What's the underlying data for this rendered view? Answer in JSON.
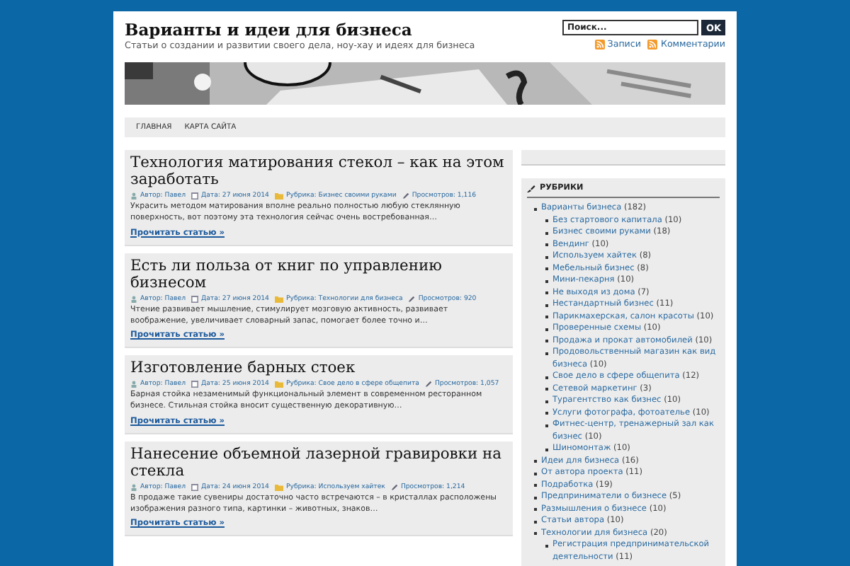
{
  "site": {
    "title": "Варианты и идеи для бизнеса",
    "tagline": "Статьи о создании и развитии своего дела, ноу-хау и идеях для бизнеса"
  },
  "search": {
    "placeholder": "Поиск...",
    "button": "OK"
  },
  "feeds": [
    "Записи",
    "Комментарии"
  ],
  "nav": [
    {
      "label": "ГЛАВНАЯ",
      "selected": false
    },
    {
      "label": "КАРТА САЙТА",
      "selected": false
    }
  ],
  "posts": [
    {
      "title": "Технология матирования стекол – как на этом заработать",
      "author": "Автор: Павел",
      "date": "Дата: 27 июня 2014",
      "category": "Рубрика: Бизнес своими руками",
      "views": "Просмотров: 1,116",
      "excerpt": "Украсить методом матирования вполне реально полностью любую стеклянную поверхность, вот поэтому эта технология сейчас очень востребованная…",
      "more": "Прочитать статью »"
    },
    {
      "title": "Есть ли польза от книг по управлению бизнесом",
      "author": "Автор: Павел",
      "date": "Дата: 27 июня 2014",
      "category": "Рубрика: Технологии для бизнеса",
      "views": "Просмотров: 920",
      "excerpt": "Чтение развивает мышление, стимулирует мозговую активность, развивает воображение, увеличивает словарный запас, помогает более точно и…",
      "more": "Прочитать статью »"
    },
    {
      "title": "Изготовление барных стоек",
      "author": "Автор: Павел",
      "date": "Дата: 25 июня 2014",
      "category": "Рубрика: Свое дело в сфере общепита",
      "views": "Просмотров: 1,057",
      "excerpt": "Барная стойка незаменимый функциональный элемент в современном ресторанном бизнесе. Стильная стойка вносит существенную декоративную…",
      "more": "Прочитать статью »"
    },
    {
      "title": "Нанесение объемной лазерной гравировки на стекла",
      "author": "Автор: Павел",
      "date": "Дата: 24 июня 2014",
      "category": "Рубрика: Используем хайтек",
      "views": "Просмотров: 1,214",
      "excerpt": "В продаже такие сувениры достаточно часто встречаются – в кристаллах расположены изображения разного типа, картинки – животных, знаков…",
      "more": "Прочитать статью »"
    }
  ],
  "sidebar": {
    "heading": "РУБРИКИ",
    "categories": [
      {
        "name": "Варианты бизнеса",
        "count": "(182)",
        "children": [
          {
            "name": "Без стартового капитала",
            "count": "(10)"
          },
          {
            "name": "Бизнес своими руками",
            "count": "(18)"
          },
          {
            "name": "Вендинг",
            "count": "(10)"
          },
          {
            "name": "Используем хайтек",
            "count": "(8)"
          },
          {
            "name": "Мебельный бизнес",
            "count": "(8)"
          },
          {
            "name": "Мини-пекарня",
            "count": "(10)"
          },
          {
            "name": "Не выходя из дома",
            "count": "(7)"
          },
          {
            "name": "Нестандартный бизнес",
            "count": "(11)"
          },
          {
            "name": "Парикмахерская, салон красоты",
            "count": "(10)"
          },
          {
            "name": "Проверенные схемы",
            "count": "(10)"
          },
          {
            "name": "Продажа и прокат автомобилей",
            "count": "(10)"
          },
          {
            "name": "Продовольственный магазин как вид бизнеса",
            "count": "(10)"
          },
          {
            "name": "Свое дело в сфере общепита",
            "count": "(12)"
          },
          {
            "name": "Сетевой маркетинг",
            "count": "(3)"
          },
          {
            "name": "Турагентство как бизнес",
            "count": "(10)"
          },
          {
            "name": "Услуги фотографа, фотоателье",
            "count": "(10)"
          },
          {
            "name": "Фитнес-центр, тренажерный зал как бизнес",
            "count": "(10)"
          },
          {
            "name": "Шиномонтаж",
            "count": "(10)"
          }
        ]
      },
      {
        "name": "Идеи для бизнеса",
        "count": "(16)"
      },
      {
        "name": "От автора проекта",
        "count": "(11)"
      },
      {
        "name": "Подработка",
        "count": "(19)"
      },
      {
        "name": "Предприниматели о бизнесе",
        "count": "(5)"
      },
      {
        "name": "Размышления о бизнесе",
        "count": "(10)"
      },
      {
        "name": "Статьи автора",
        "count": "(10)"
      },
      {
        "name": "Технологии для бизнеса",
        "count": "(20)",
        "children": [
          {
            "name": "Регистрация предпринимательской деятельности",
            "count": "(11)"
          }
        ]
      }
    ]
  }
}
